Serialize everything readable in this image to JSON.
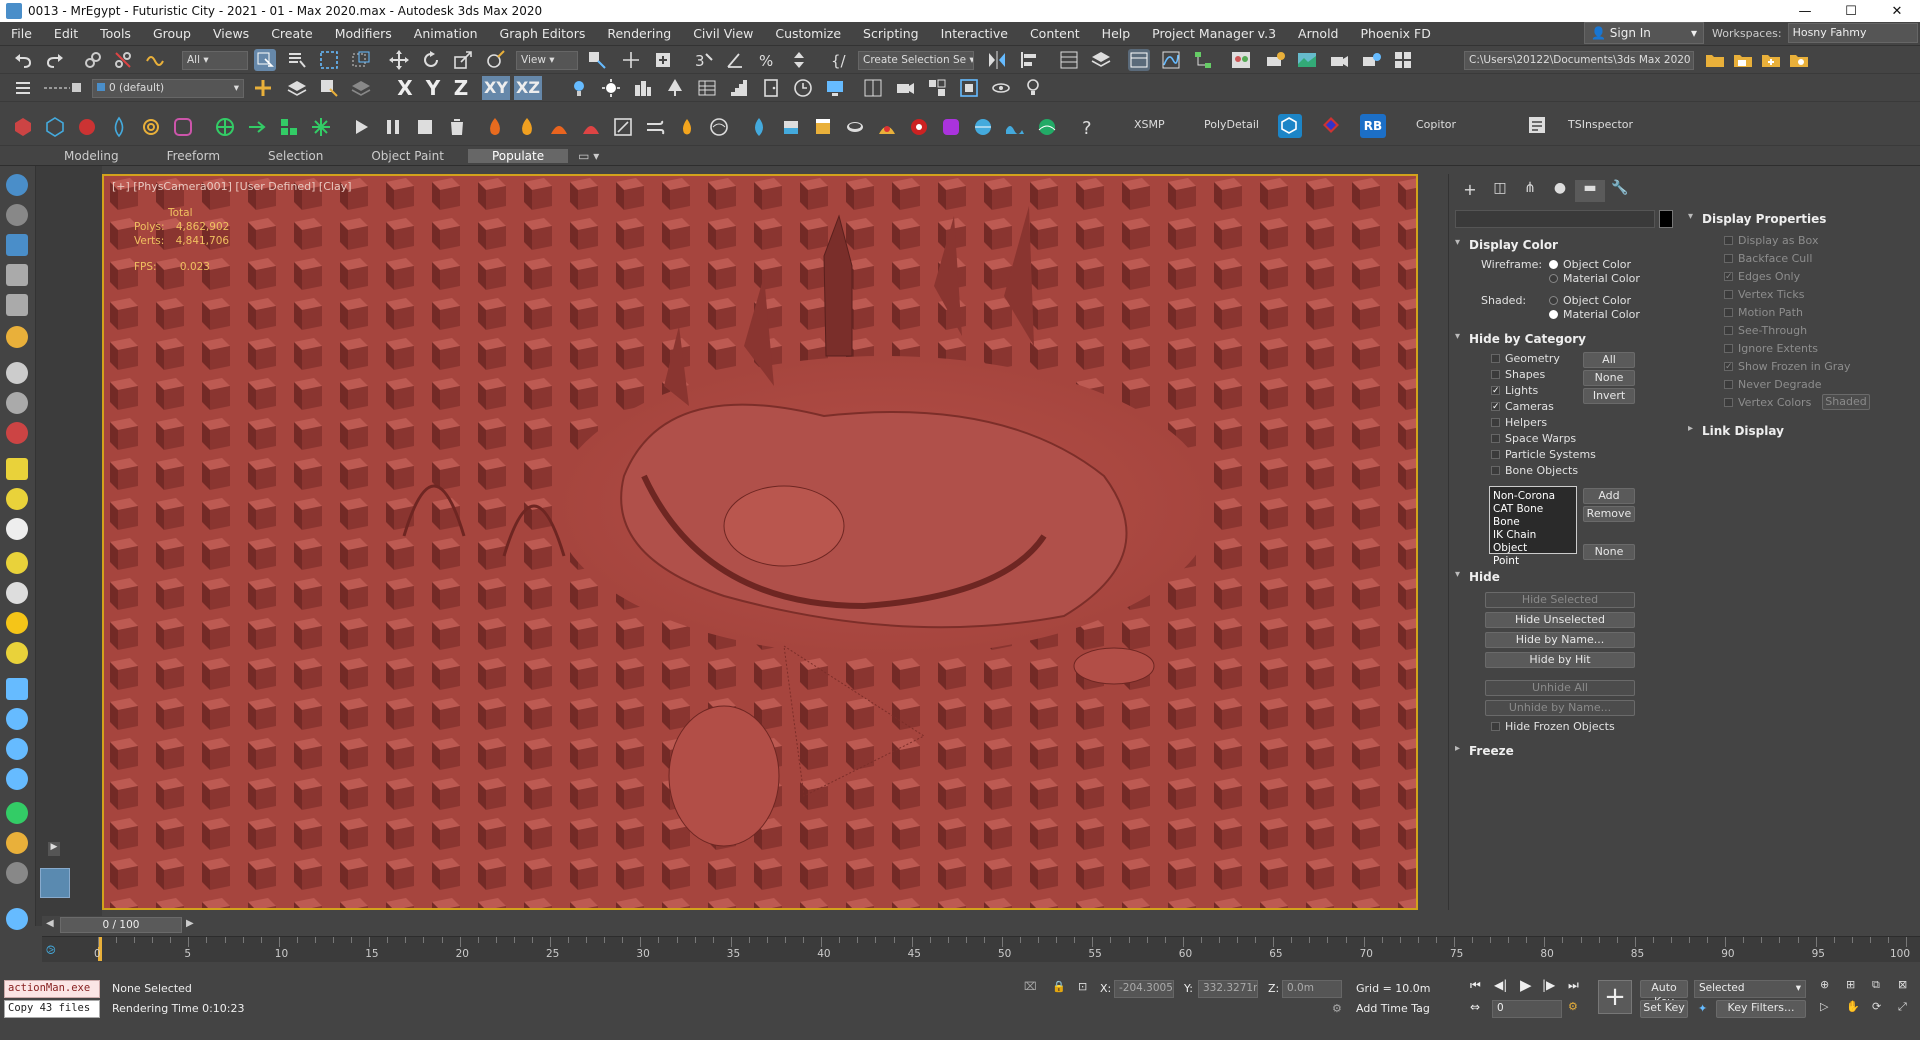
{
  "window": {
    "title": "0013 - MrEgypt - Futuristic City - 2021 - 01 - Max 2020.max - Autodesk 3ds Max 2020",
    "controls": [
      "—",
      "☐",
      "✕"
    ]
  },
  "menu": [
    "File",
    "Edit",
    "Tools",
    "Group",
    "Views",
    "Create",
    "Modifiers",
    "Animation",
    "Graph Editors",
    "Rendering",
    "Civil View",
    "Customize",
    "Scripting",
    "Interactive",
    "Content",
    "Help",
    "Project Manager v.3",
    "Arnold",
    "Phoenix FD"
  ],
  "account": {
    "signin": "Sign In",
    "workspaces_label": "Workspaces:",
    "workspace": "Hosny Fahmy"
  },
  "toolbar1": {
    "filter": "All",
    "ref_coord": "View",
    "selection_set": "Create Selection Se",
    "project_path": "C:\\Users\\20122\\Documents\\3ds Max 2020"
  },
  "toolbar2": {
    "layer": "0 (default)",
    "axes": [
      "X",
      "Y",
      "Z",
      "XY",
      "XZ"
    ]
  },
  "toolbar3": {
    "labels": [
      "XSMP",
      "PolyDetail",
      "RB",
      "Copitor",
      "TSInspector"
    ]
  },
  "ribbon_tabs": [
    "Modeling",
    "Freeform",
    "Selection",
    "Object Paint",
    "Populate"
  ],
  "ribbon_active": "Populate",
  "viewport": {
    "label": "[+] [PhysCamera001] [User Defined] [Clay]",
    "stats": {
      "total_label": "Total",
      "polys_label": "Polys:",
      "polys": "4,862,902",
      "verts_label": "Verts:",
      "verts": "4,841,706",
      "fps_label": "FPS:",
      "fps": "0.023"
    },
    "bg_color": "#a6453e"
  },
  "command_panel": {
    "tabs": [
      "create",
      "modify",
      "hierarchy",
      "motion",
      "display",
      "utilities"
    ],
    "active_tab": "display",
    "display_color": {
      "title": "Display Color",
      "wireframe_label": "Wireframe:",
      "shaded_label": "Shaded:",
      "options": [
        "Object Color",
        "Material Color"
      ],
      "wireframe_selected": "Object Color",
      "shaded_selected": "Material Color"
    },
    "hide_by_category": {
      "title": "Hide by Category",
      "items": [
        {
          "label": "Geometry",
          "checked": false
        },
        {
          "label": "Shapes",
          "checked": false
        },
        {
          "label": "Lights",
          "checked": true
        },
        {
          "label": "Cameras",
          "checked": true
        },
        {
          "label": "Helpers",
          "checked": false
        },
        {
          "label": "Space Warps",
          "checked": false
        },
        {
          "label": "Particle Systems",
          "checked": false
        },
        {
          "label": "Bone Objects",
          "checked": false
        }
      ],
      "buttons": [
        "All",
        "None",
        "Invert"
      ],
      "list": [
        "Non-Corona",
        "CAT Bone",
        "Bone",
        "IK Chain Object",
        "Point"
      ],
      "list_buttons": [
        "Add",
        "Remove",
        "None"
      ]
    },
    "hide": {
      "title": "Hide",
      "buttons": [
        {
          "label": "Hide Selected",
          "enabled": false
        },
        {
          "label": "Hide Unselected",
          "enabled": true
        },
        {
          "label": "Hide by Name...",
          "enabled": true
        },
        {
          "label": "Hide by Hit",
          "enabled": true
        },
        {
          "label": "Unhide All",
          "enabled": false
        },
        {
          "label": "Unhide by Name...",
          "enabled": false
        }
      ],
      "hide_frozen": "Hide Frozen Objects"
    },
    "freeze": {
      "title": "Freeze"
    }
  },
  "display_properties": {
    "title": "Display Properties",
    "items": [
      {
        "label": "Display as Box",
        "checked": false
      },
      {
        "label": "Backface Cull",
        "checked": false
      },
      {
        "label": "Edges Only",
        "checked": true
      },
      {
        "label": "Vertex Ticks",
        "checked": false
      },
      {
        "label": "Motion Path",
        "checked": false
      },
      {
        "label": "See-Through",
        "checked": false
      },
      {
        "label": "Ignore Extents",
        "checked": false
      },
      {
        "label": "Show Frozen in Gray",
        "checked": true
      },
      {
        "label": "Never Degrade",
        "checked": false
      },
      {
        "label": "Vertex Colors",
        "checked": false
      }
    ],
    "shaded_btn": "Shaded",
    "link_display": "Link Display"
  },
  "timeline": {
    "slider": "0 / 100",
    "ticks": [
      "0",
      "5",
      "10",
      "15",
      "20",
      "25",
      "30",
      "35",
      "40",
      "45",
      "50",
      "55",
      "60",
      "65",
      "70",
      "75",
      "80",
      "85",
      "90",
      "95",
      "100"
    ]
  },
  "status": {
    "maxscript1": "actionMan.exe",
    "maxscript2": "Copy 43 files",
    "selection": "None Selected",
    "render_time": "Rendering Time  0:10:23",
    "x_label": "X:",
    "x": "-204.3005",
    "y_label": "Y:",
    "y": "332.3271m",
    "z_label": "Z:",
    "z": "0.0m",
    "grid": "Grid = 10.0m",
    "add_time_tag": "Add Time Tag",
    "autokey": "Auto Key",
    "setkey": "Set Key",
    "selected_dd": "Selected",
    "frame": "0",
    "key_filters": "Key Filters..."
  }
}
